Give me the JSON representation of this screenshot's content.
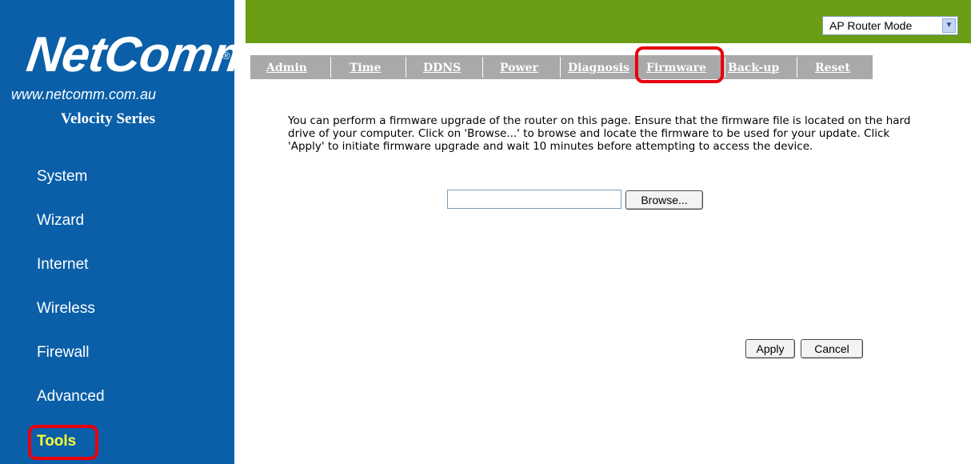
{
  "brand": {
    "logo_text": "NetComm",
    "logo_mark": "®",
    "url": "www.netcomm.com.au",
    "series": "Velocity Series"
  },
  "sidebar": {
    "items": [
      {
        "label": "System"
      },
      {
        "label": "Wizard"
      },
      {
        "label": "Internet"
      },
      {
        "label": "Wireless"
      },
      {
        "label": "Firewall"
      },
      {
        "label": "Advanced"
      },
      {
        "label": "Tools"
      }
    ],
    "active": "Tools"
  },
  "topbar": {
    "mode_select": {
      "value": "AP Router Mode",
      "icon": "chevron-down-icon"
    }
  },
  "tabs": [
    {
      "label": "Admin"
    },
    {
      "label": "Time"
    },
    {
      "label": "DDNS"
    },
    {
      "label": "Power"
    },
    {
      "label": "Diagnosis"
    },
    {
      "label": "Firmware"
    },
    {
      "label": "Back-up"
    },
    {
      "label": "Reset"
    }
  ],
  "active_tab": "Firmware",
  "content": {
    "description": "You can perform a firmware upgrade of the router on this page. Ensure that the firmware file is located on the hard drive of your computer. Click on 'Browse...' to browse and locate the firmware to be used for your update. Click 'Apply' to initiate firmware upgrade and wait 10 minutes before attempting to access the device.",
    "file_input_value": "",
    "browse_label": "Browse...",
    "apply_label": "Apply",
    "cancel_label": "Cancel"
  },
  "colors": {
    "sidebar_bg": "#0a5fa8",
    "topbar_bg": "#6b9e15",
    "tabbar_bg": "#a9a9a9",
    "active_nav": "#ffff33",
    "highlight": "#e8000c"
  }
}
